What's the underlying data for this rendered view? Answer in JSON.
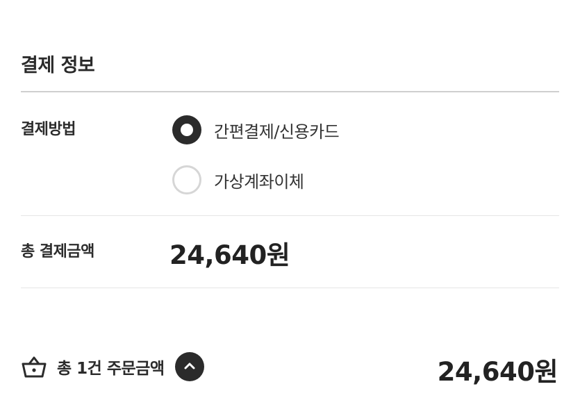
{
  "section": {
    "title": "결제 정보"
  },
  "payment_method": {
    "label": "결제방법",
    "options": [
      {
        "label": "간편결제/신용카드",
        "selected": true
      },
      {
        "label": "가상계좌이체",
        "selected": false
      }
    ]
  },
  "total_payment": {
    "label": "총 결제금액",
    "amount": "24,640원"
  },
  "footer": {
    "icon": "basket-icon",
    "label": "총 1건 주문금액",
    "toggle_icon": "chevron-up-icon",
    "amount": "24,640원"
  },
  "colors": {
    "text_primary": "#2b2b2b",
    "divider": "#cfcfcf",
    "radio_unchecked": "#d6d6d6"
  }
}
